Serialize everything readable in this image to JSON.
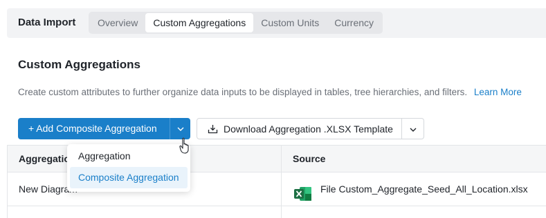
{
  "header": {
    "title": "Data Import",
    "tabs": [
      {
        "label": "Overview",
        "active": false
      },
      {
        "label": "Custom Aggregations",
        "active": true
      },
      {
        "label": "Custom Units",
        "active": false
      },
      {
        "label": "Currency",
        "active": false
      }
    ]
  },
  "section": {
    "title": "Custom Aggregations",
    "description": "Create custom attributes to further organize data inputs to be displayed in tables, tree hierarchies, and filters.",
    "learn_more": "Learn More"
  },
  "toolbar": {
    "add_button_label": "+ Add Composite Aggregation",
    "download_button_label": "Download Aggregation .XLSX Template"
  },
  "dropdown": {
    "items": [
      {
        "label": "Aggregation",
        "selected": false
      },
      {
        "label": "Composite Aggregation",
        "selected": true
      }
    ]
  },
  "table": {
    "columns": [
      "Aggregation",
      "Source"
    ],
    "rows": [
      {
        "name": "New Diagram",
        "source": "File Custom_Aggregate_Seed_All_Location.xlsx"
      }
    ]
  },
  "colors": {
    "accent": "#1a7fc9",
    "excel_green": "#1d7044"
  },
  "icons": {
    "add_toggle": "chevron-down-icon",
    "download": "download-icon",
    "download_toggle": "chevron-down-icon",
    "file": "excel-file-icon",
    "pointer": "hand-pointer-cursor-icon"
  }
}
